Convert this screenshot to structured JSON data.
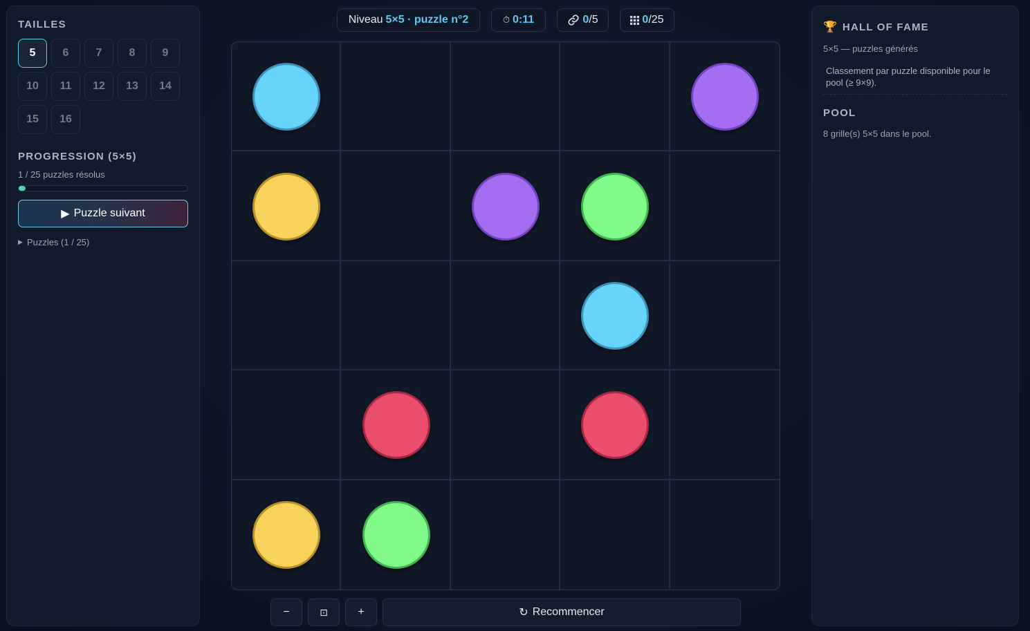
{
  "left": {
    "sizes_title": "TAILLES",
    "sizes": [
      "5",
      "6",
      "7",
      "8",
      "9",
      "10",
      "11",
      "12",
      "13",
      "14",
      "15",
      "16"
    ],
    "active_size": "5",
    "progress_title": "PROGRESSION (5×5)",
    "progress_text": "1 / 25 puzzles résolus",
    "progress_value": 0.04,
    "next_label": "Puzzle suivant",
    "puzzles_toggle": "Puzzles (1 / 25)"
  },
  "stats": {
    "level_prefix": "Niveau",
    "level_value": "5×5 · puzzle n°2",
    "timer": "0:11",
    "links": "0",
    "links_total": "/5",
    "cells": "0",
    "cells_total": "/25"
  },
  "board": {
    "size": 5,
    "dots": [
      {
        "row": 0,
        "col": 0,
        "color": "blue"
      },
      {
        "row": 0,
        "col": 4,
        "color": "purple"
      },
      {
        "row": 1,
        "col": 0,
        "color": "yellow"
      },
      {
        "row": 1,
        "col": 2,
        "color": "purple"
      },
      {
        "row": 1,
        "col": 3,
        "color": "green"
      },
      {
        "row": 2,
        "col": 3,
        "color": "blue"
      },
      {
        "row": 3,
        "col": 1,
        "color": "red"
      },
      {
        "row": 3,
        "col": 3,
        "color": "red"
      },
      {
        "row": 4,
        "col": 0,
        "color": "yellow"
      },
      {
        "row": 4,
        "col": 1,
        "color": "green"
      }
    ]
  },
  "colors": {
    "blue": {
      "fill": "#67d4fb",
      "stroke": "#3f91b8"
    },
    "purple": {
      "fill": "#a56ef2",
      "stroke": "#7344c4"
    },
    "yellow": {
      "fill": "#f8d35b",
      "stroke": "#b89128"
    },
    "green": {
      "fill": "#80fb8a",
      "stroke": "#43b550"
    },
    "red": {
      "fill": "#eb4d6d",
      "stroke": "#a82845"
    }
  },
  "controls": {
    "zoom_out": "−",
    "fit": "⊡",
    "zoom_in": "+",
    "restart": "Recommencer"
  },
  "right": {
    "hof_title": "HALL OF FAME",
    "hof_sub": "5×5 — puzzles générés",
    "hof_note": "Classement par puzzle disponible pour le pool (≥ 9×9).",
    "pool_title": "POOL",
    "pool_text": "8 grille(s) 5×5 dans le pool."
  }
}
